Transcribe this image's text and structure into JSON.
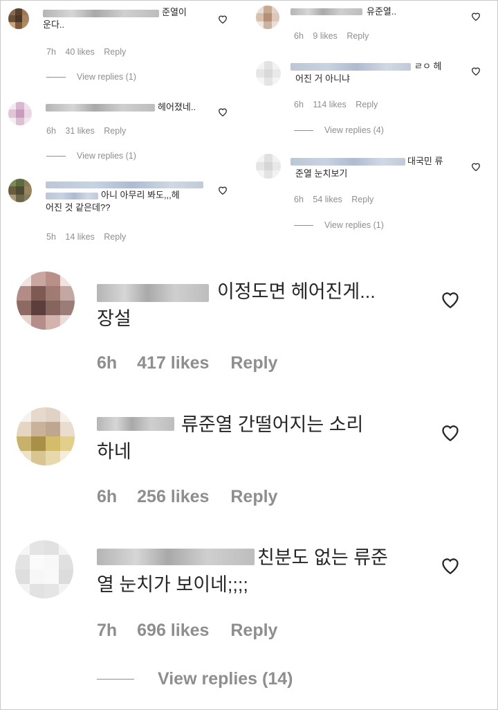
{
  "small_left": [
    {
      "text": "준열이\n운다..",
      "time": "7h",
      "likes": "40 likes",
      "reply": "Reply",
      "view_replies": "View replies (1)"
    },
    {
      "text": "헤어졌네..",
      "time": "6h",
      "likes": "31 likes",
      "reply": "Reply",
      "view_replies": "View replies (1)"
    },
    {
      "text": "아니 아무리 봐도,,,헤\n어진 것 같은데??",
      "time": "5h",
      "likes": "14 likes",
      "reply": "Reply"
    }
  ],
  "small_right": [
    {
      "text": "유준열..",
      "time": "6h",
      "likes": "9 likes",
      "reply": "Reply"
    },
    {
      "text": "ㄹㅇ 헤\n어진 거 아니냐",
      "time": "6h",
      "likes": "114 likes",
      "reply": "Reply",
      "view_replies": "View replies (4)"
    },
    {
      "text": "대국민 류\n준열 눈치보기",
      "time": "6h",
      "likes": "54 likes",
      "reply": "Reply",
      "view_replies": "View replies (1)"
    }
  ],
  "large": [
    {
      "text": "이정도면 헤어진게...\n장설",
      "time": "6h",
      "likes": "417 likes",
      "reply": "Reply"
    },
    {
      "text": "류준열 간떨어지는 소리\n하네",
      "time": "6h",
      "likes": "256 likes",
      "reply": "Reply"
    },
    {
      "text": "친분도 없는 류준\n열 눈치가 보이네;;;;",
      "time": "7h",
      "likes": "696 likes",
      "reply": "Reply",
      "view_replies": "View replies (14)"
    }
  ],
  "icons": {
    "like": "heart-outline-icon"
  },
  "colors": {
    "text": "#262626",
    "meta": "#8e8e8e"
  }
}
